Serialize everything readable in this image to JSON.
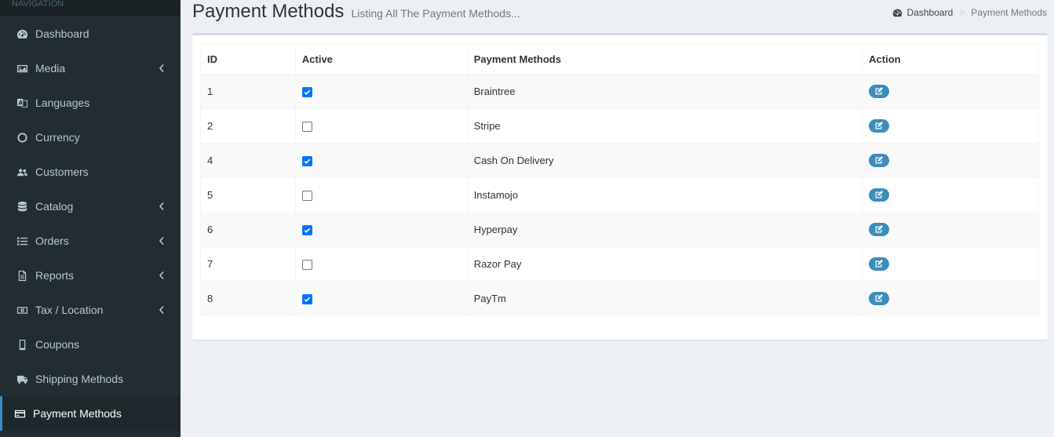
{
  "sidebar": {
    "header": "NAVIGATION",
    "items": [
      {
        "label": "Dashboard",
        "icon": "dashboard-icon",
        "chevron": false,
        "active": false
      },
      {
        "label": "Media",
        "icon": "image-icon",
        "chevron": true,
        "active": false
      },
      {
        "label": "Languages",
        "icon": "language-icon",
        "chevron": false,
        "active": false
      },
      {
        "label": "Currency",
        "icon": "circle-icon",
        "chevron": false,
        "active": false
      },
      {
        "label": "Customers",
        "icon": "users-icon",
        "chevron": false,
        "active": false
      },
      {
        "label": "Catalog",
        "icon": "database-icon",
        "chevron": true,
        "active": false
      },
      {
        "label": "Orders",
        "icon": "list-icon",
        "chevron": true,
        "active": false
      },
      {
        "label": "Reports",
        "icon": "file-icon",
        "chevron": true,
        "active": false
      },
      {
        "label": "Tax / Location",
        "icon": "money-icon",
        "chevron": true,
        "active": false
      },
      {
        "label": "Coupons",
        "icon": "tablet-icon",
        "chevron": false,
        "active": false
      },
      {
        "label": "Shipping Methods",
        "icon": "truck-icon",
        "chevron": false,
        "active": false
      },
      {
        "label": "Payment Methods",
        "icon": "credit-card-icon",
        "chevron": false,
        "active": true
      }
    ]
  },
  "header": {
    "title": "Payment Methods",
    "subtitle": "Listing All The Payment Methods..."
  },
  "breadcrumb": {
    "home": "Dashboard",
    "separator": ">",
    "current": "Payment Methods"
  },
  "table": {
    "columns": [
      "ID",
      "Active",
      "Payment Methods",
      "Action"
    ],
    "rows": [
      {
        "id": "1",
        "active": true,
        "name": "Braintree"
      },
      {
        "id": "2",
        "active": false,
        "name": "Stripe"
      },
      {
        "id": "4",
        "active": true,
        "name": "Cash On Delivery"
      },
      {
        "id": "5",
        "active": false,
        "name": "Instamojo"
      },
      {
        "id": "6",
        "active": true,
        "name": "Hyperpay"
      },
      {
        "id": "7",
        "active": false,
        "name": "Razor Pay"
      },
      {
        "id": "8",
        "active": true,
        "name": "PayTm"
      }
    ]
  },
  "colors": {
    "sidebar_bg": "#222d32",
    "accent": "#3c8dbc",
    "checkbox_checked": "#0075ff"
  }
}
